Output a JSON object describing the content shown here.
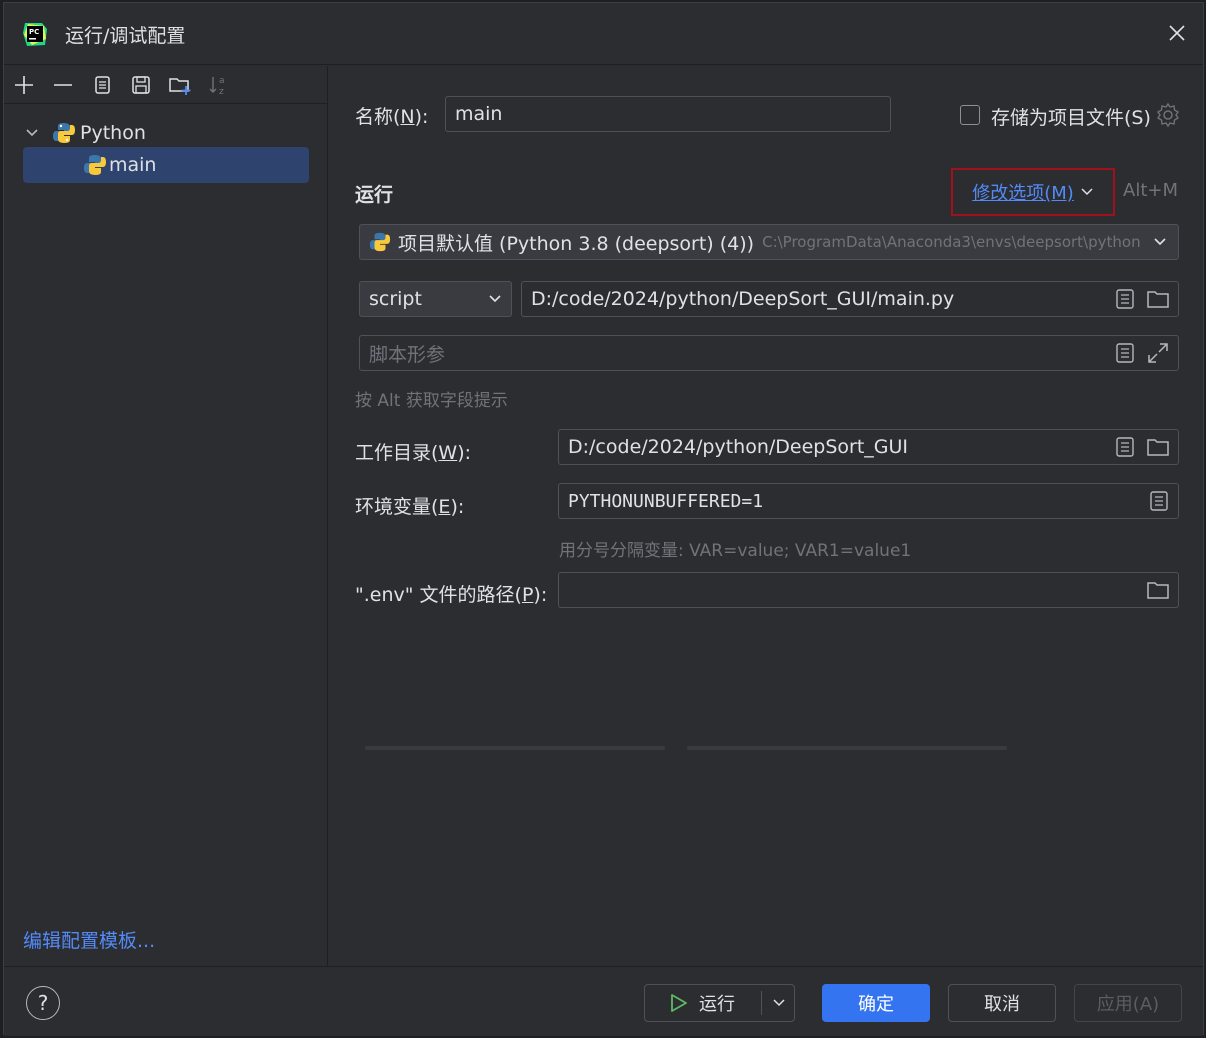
{
  "window": {
    "title": "运行/调试配置",
    "app_icon": "pycharm-icon"
  },
  "toolbar": {
    "buttons": [
      {
        "name": "add-icon",
        "glyph": "+"
      },
      {
        "name": "remove-icon",
        "glyph": "—"
      },
      {
        "name": "copy-icon",
        "glyph": "copy"
      },
      {
        "name": "save-icon",
        "glyph": "save"
      },
      {
        "name": "new-folder-icon",
        "glyph": "folder-add"
      },
      {
        "name": "sort-icon",
        "glyph": "sort"
      }
    ]
  },
  "tree": {
    "group_label": "Python",
    "selected_item": "main"
  },
  "left_footer": {
    "edit_templates": "编辑配置模板..."
  },
  "form": {
    "name_label_prefix": "名称(",
    "name_label_key": "N",
    "name_label_suffix": "):",
    "name_value": "main",
    "store_as_file_label": "存储为项目文件(S)",
    "run_section": "运行",
    "modify_options": "修改选项(M)",
    "modify_shortcut": "Alt+M",
    "interpreter": "项目默认值 (Python 3.8 (deepsort) (4))",
    "interpreter_path": "C:\\ProgramData\\Anaconda3\\envs\\deepsort\\python",
    "script_type": "script",
    "script_path": "D:/code/2024/python/DeepSort_GUI/main.py",
    "script_params_placeholder": "脚本形参",
    "alt_hint": "按 Alt 获取字段提示",
    "workdir_label_prefix": "工作目录(",
    "workdir_label_key": "W",
    "workdir_label_suffix": "):",
    "workdir_value": "D:/code/2024/python/DeepSort_GUI",
    "env_label_prefix": "环境变量(",
    "env_label_key": "E",
    "env_label_suffix": "):",
    "env_value": "PYTHONUNBUFFERED=1",
    "env_hint": "用分号分隔变量: VAR=value; VAR1=value1",
    "dotenv_label_prefix": "\".env\" 文件的路径(",
    "dotenv_label_key": "P",
    "dotenv_label_suffix": "):",
    "dotenv_value": ""
  },
  "footer": {
    "help": "?",
    "run": "运行",
    "ok": "确定",
    "cancel": "取消",
    "apply": "应用(A)"
  },
  "colors": {
    "accent": "#3574f0",
    "link": "#548af7",
    "selection": "#2e436e",
    "highlight_border": "#a0121b",
    "run_icon": "#5fb865"
  }
}
